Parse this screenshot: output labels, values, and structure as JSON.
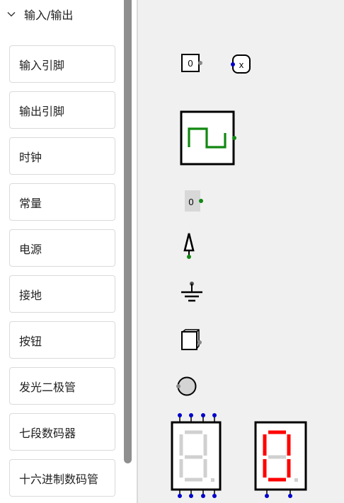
{
  "section": {
    "title": "输入/输出",
    "expanded": true
  },
  "items": [
    {
      "label": "输入引脚"
    },
    {
      "label": "输出引脚"
    },
    {
      "label": "时钟"
    },
    {
      "label": "常量"
    },
    {
      "label": "电源"
    },
    {
      "label": "接地"
    },
    {
      "label": "按钮"
    },
    {
      "label": "发光二极管"
    },
    {
      "label": "七段数码器"
    },
    {
      "label": "十六进制数码管"
    }
  ],
  "palette": {
    "input_pin_value": "0",
    "output_pin_value": "x",
    "constant_value": "0"
  },
  "colors": {
    "accent_green": "#118811",
    "pin_blue": "#0000cc",
    "segment_on": "#ff0000",
    "segment_off": "#d0d0d0",
    "canvas_bg": "#f0f0f0"
  }
}
